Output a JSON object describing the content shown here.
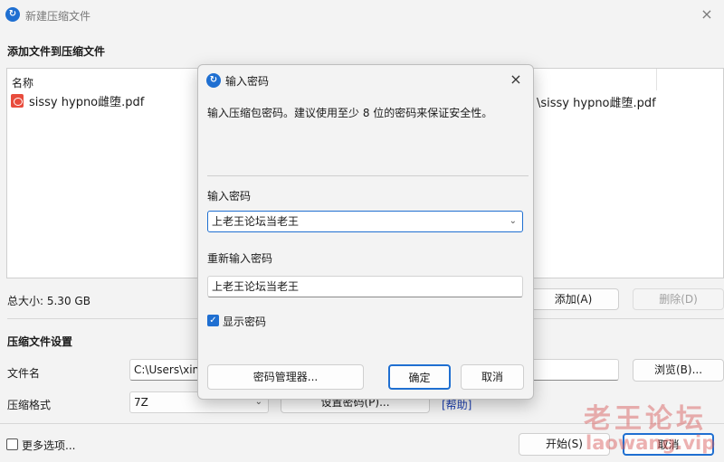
{
  "main_window": {
    "title": "新建压缩文件",
    "close_icon": "×",
    "add_files_section": "添加文件到压缩文件",
    "file_list": {
      "column_name": "名称",
      "files": [
        {
          "name": "sissy hypno雌堕.pdf",
          "path_tail": "\\sissy hypno雌堕.pdf"
        }
      ]
    },
    "total_size": "总大小: 5.30 GB",
    "add_button": "添加(A)",
    "delete_button": "删除(D)",
    "settings_section": "压缩文件设置",
    "filename_label": "文件名",
    "filename_value": "C:\\Users\\xin",
    "browse_button": "浏览(B)...",
    "format_label": "压缩格式",
    "format_value": "7Z",
    "set_password_button": "设置密码(P)...",
    "help_link": "[帮助]",
    "more_options_label": "更多选项...",
    "start_button": "开始(S)",
    "cancel_button": "取消"
  },
  "dialog": {
    "title": "输入密码",
    "close_icon": "×",
    "description": "输入压缩包密码。建议使用至少 8 位的密码来保证安全性。",
    "password_label": "输入密码",
    "password_value": "上老王论坛当老王",
    "confirm_label": "重新输入密码",
    "confirm_value": "上老王论坛当老王",
    "show_password_label": "显示密码",
    "show_password_checked": true,
    "manager_button": "密码管理器...",
    "ok_button": "确定",
    "cancel_button": "取消"
  },
  "watermark": {
    "chinese": "老王论坛",
    "latin": "laowang.vip"
  },
  "colors": {
    "accent": "#1f6fd1",
    "window_bg": "#f3f3f3",
    "watermark": "#d65555"
  }
}
